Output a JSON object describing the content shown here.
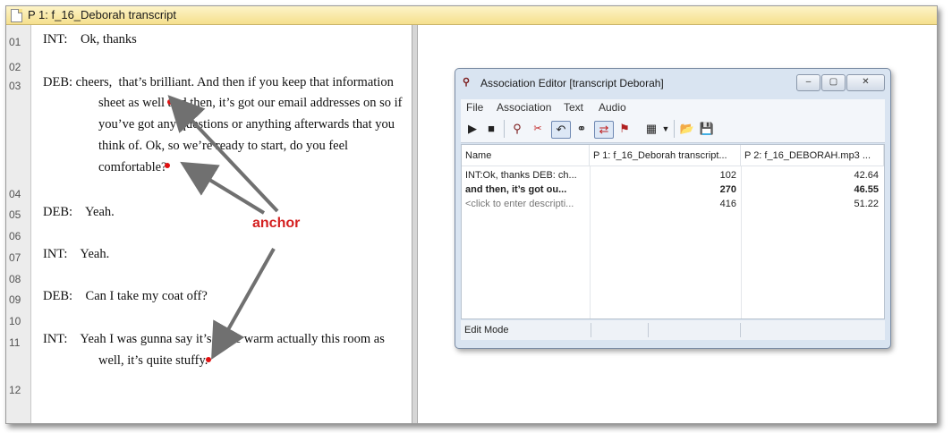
{
  "document": {
    "title": "P 1: f_16_Deborah transcript",
    "line_numbers": [
      "01",
      "02",
      "03",
      "04",
      "05",
      "06",
      "07",
      "08",
      "09",
      "10",
      "11",
      "12"
    ],
    "lines": [
      "INT:    Ok, thanks",
      "DEB: cheers,  that’s brilliant. And then if you keep that information",
      "sheet as well and then, it’s got our email addresses on so if",
      "you’ve got any questions or anything afterwards that you",
      "think of. Ok, so we’re ready to start, do you feel",
      "comfortable?",
      "DEB:    Yeah.",
      "INT:    Yeah.",
      "DEB:    Can I take my coat off?",
      "INT:    Yeah I was gunna say it’s quite warm actually this room as",
      "well, it’s quite stuffy."
    ]
  },
  "annotation": {
    "label": "anchor",
    "color": "#d42020"
  },
  "editor": {
    "title": "Association Editor [transcript Deborah]",
    "window_buttons": [
      "–",
      "▢",
      "✕"
    ],
    "menu": [
      "File",
      "Association",
      "Text",
      "Audio"
    ],
    "columns": [
      "Name",
      "P 1: f_16_Deborah transcript...",
      "P 2: f_16_DEBORAH.mp3 ..."
    ],
    "rows": [
      {
        "name": "INT:Ok, thanks DEB: ch...",
        "text_pos": "102",
        "audio_pos": "42.64",
        "bold": false
      },
      {
        "name": "and then, it’s got ou...",
        "text_pos": "270",
        "audio_pos": "46.55",
        "bold": true
      },
      {
        "name": "<click to enter descripti...",
        "text_pos": "416",
        "audio_pos": "51.22",
        "bold": false
      }
    ],
    "status": "Edit Mode"
  },
  "colors": {
    "title_bar": "#f5e08d",
    "anchor_dot": "#e01010",
    "window_frame": "#d9e4f1"
  }
}
